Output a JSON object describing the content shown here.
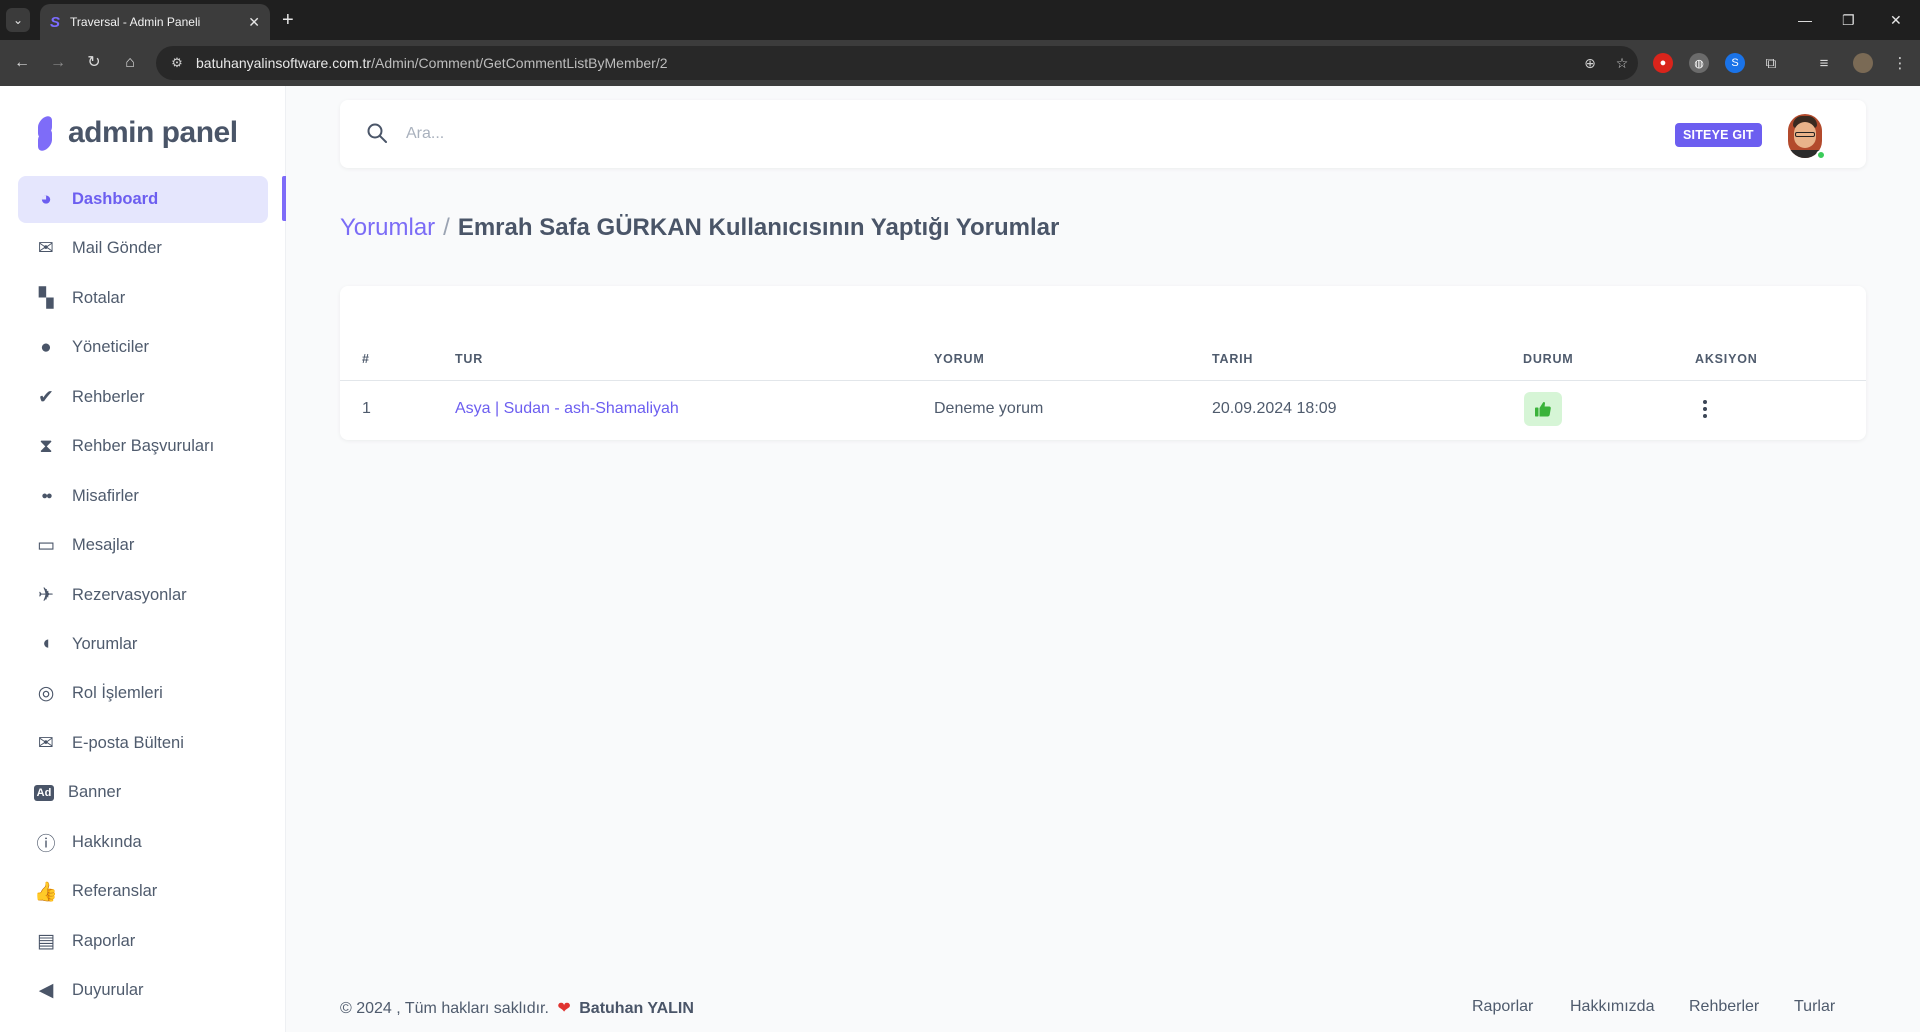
{
  "browser": {
    "tab_title": "Traversal - Admin Paneli",
    "url_host": "batuhanyalinsoftware.com.tr",
    "url_path": "/Admin/Comment/GetCommentListByMember/2"
  },
  "brand": {
    "title": "admin panel"
  },
  "sidebar": {
    "items": [
      {
        "label": "Dashboard",
        "icon": "dashboard-icon",
        "active": true
      },
      {
        "label": "Mail Gönder",
        "icon": "mail-send-icon"
      },
      {
        "label": "Rotalar",
        "icon": "map-icon"
      },
      {
        "label": "Yöneticiler",
        "icon": "user-icon"
      },
      {
        "label": "Rehberler",
        "icon": "user-check-icon"
      },
      {
        "label": "Rehber Başvuruları",
        "icon": "hourglass-icon"
      },
      {
        "label": "Misafirler",
        "icon": "users-icon"
      },
      {
        "label": "Mesajlar",
        "icon": "inbox-icon"
      },
      {
        "label": "Rezervasyonlar",
        "icon": "plane-departure-icon"
      },
      {
        "label": "Yorumlar",
        "icon": "comments-icon"
      },
      {
        "label": "Rol İşlemleri",
        "icon": "fingerprint-icon"
      },
      {
        "label": "E-posta Bülteni",
        "icon": "envelope-icon"
      },
      {
        "label": "Banner",
        "icon": "ad-icon"
      },
      {
        "label": "Hakkında",
        "icon": "info-icon"
      },
      {
        "label": "Referanslar",
        "icon": "thumbs-up-icon"
      },
      {
        "label": "Raporlar",
        "icon": "pdf-file-icon"
      },
      {
        "label": "Duyurular",
        "icon": "megaphone-icon"
      }
    ]
  },
  "topbar": {
    "search_placeholder": "Ara...",
    "site_button": "SITEYE GIT"
  },
  "breadcrumb": {
    "parent": "Yorumlar",
    "separator": "/",
    "current": "Emrah Safa GÜRKAN Kullanıcısının Yaptığı Yorumlar"
  },
  "table": {
    "headers": {
      "num": "#",
      "tour": "TUR",
      "comment": "YORUM",
      "date": "TARIH",
      "status": "DURUM",
      "action": "AKSIYON"
    },
    "rows": [
      {
        "num": "1",
        "tour": "Asya | Sudan - ash-Shamaliyah",
        "comment": "Deneme yorum",
        "date": "20.09.2024 18:09",
        "status": "approved"
      }
    ]
  },
  "footer": {
    "copyright": "© 2024 , Tüm hakları saklıdır.",
    "author": "Batuhan YALIN",
    "links": [
      "Raporlar",
      "Hakkımızda",
      "Rehberler",
      "Turlar"
    ]
  },
  "colors": {
    "accent": "#6c5ef0",
    "status_bg": "#d6f5d6",
    "status_fg": "#3bb33b"
  }
}
